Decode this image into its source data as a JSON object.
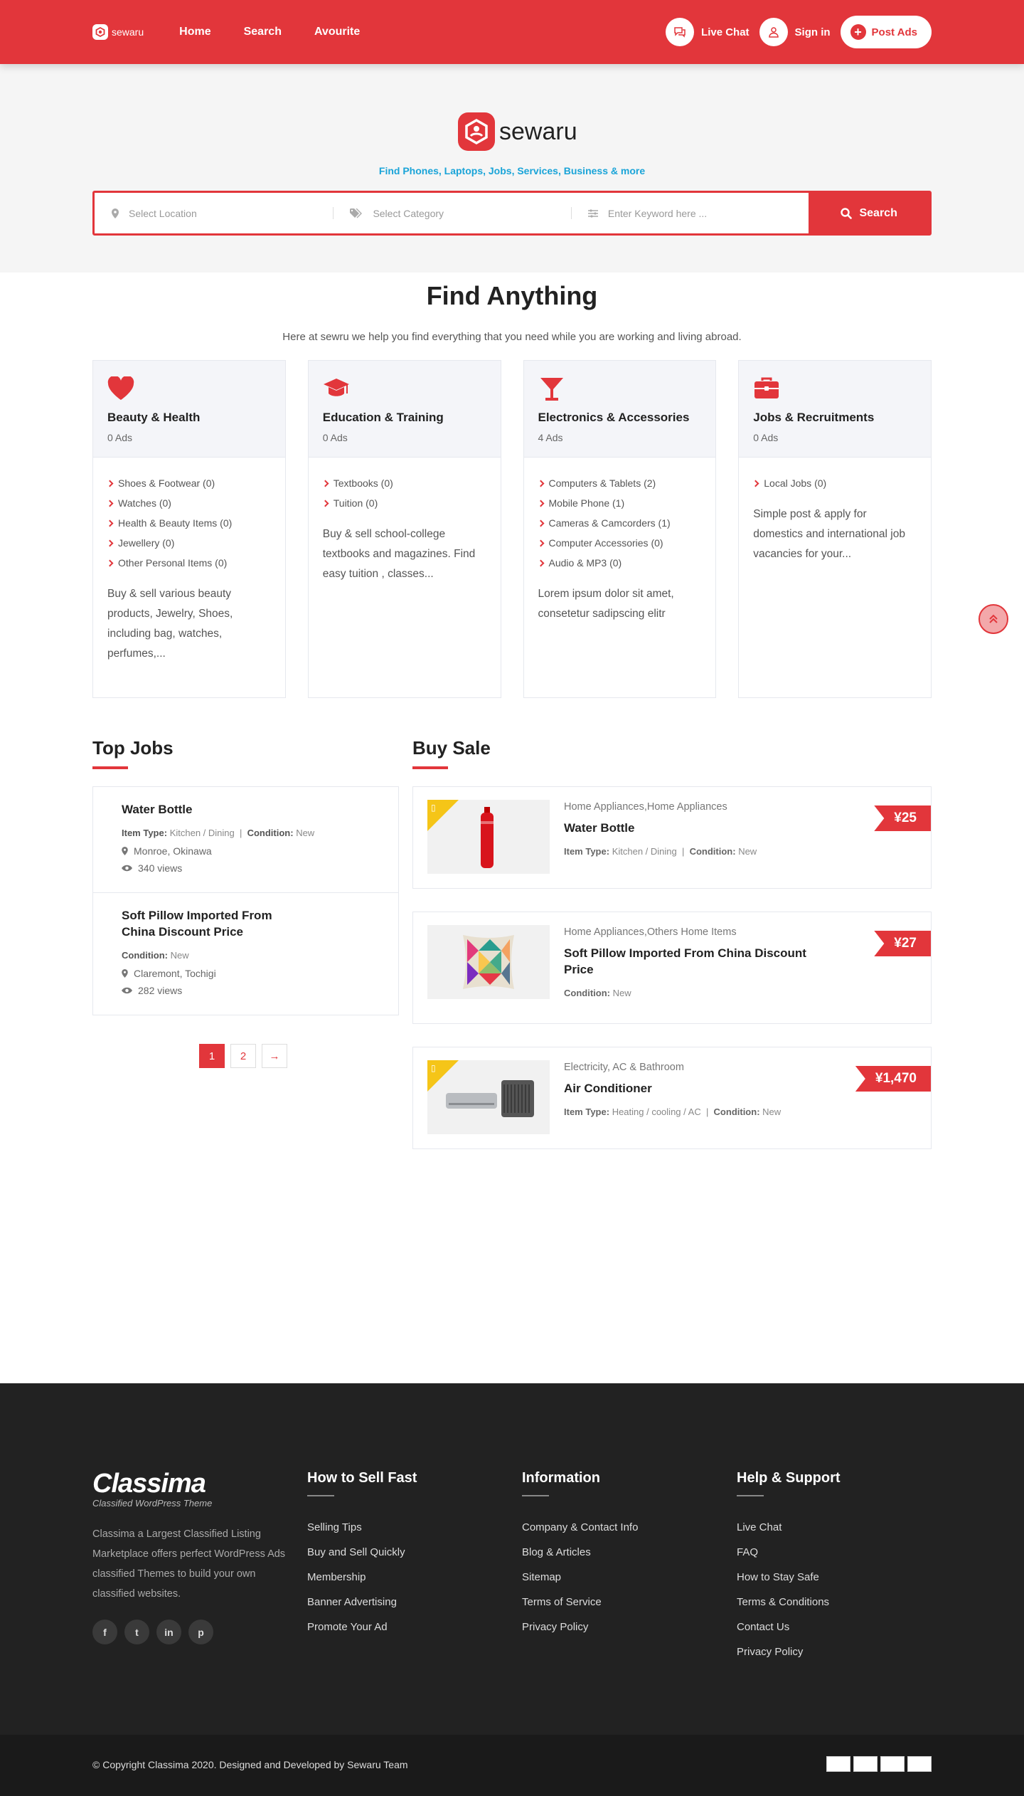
{
  "header": {
    "brand": "sewaru",
    "nav": [
      "Home",
      "Search",
      "Avourite"
    ],
    "live_chat": "Live Chat",
    "sign_in": "Sign in",
    "post_ads": "Post Ads"
  },
  "hero": {
    "brand": "sewaru",
    "tagline": "Find Phones, Laptops, Jobs, Services, Business & more",
    "location_placeholder": "Select Location",
    "category_placeholder": "Select Category",
    "keyword_placeholder": "Enter Keyword here ...",
    "search_label": "Search"
  },
  "find": {
    "title": "Find Anything",
    "description": "Here at sewru we help you find everything that you need while you are working and living abroad."
  },
  "categories": [
    {
      "icon": "heart-icon",
      "title": "Beauty & Health",
      "count": "0 Ads",
      "items": [
        "Shoes & Footwear (0)",
        "Watches (0)",
        "Health & Beauty Items (0)",
        "Jewellery (0)",
        "Other Personal Items (0)"
      ],
      "desc": "Buy & sell various beauty products, Jewelry, Shoes, including bag, watches, perfumes,..."
    },
    {
      "icon": "graduation-cap-icon",
      "title": "Education & Training",
      "count": "0 Ads",
      "items": [
        "Textbooks (0)",
        "Tuition (0)"
      ],
      "desc": "Buy & sell school-college textbooks and magazines. Find easy tuition , classes..."
    },
    {
      "icon": "cocktail-glass-icon",
      "title": "Electronics & Accessories",
      "count": "4 Ads",
      "items": [
        "Computers & Tablets (2)",
        "Mobile Phone (1)",
        "Cameras & Camcorders (1)",
        "Computer Accessories (0)",
        "Audio & MP3 (0)"
      ],
      "desc": "Lorem ipsum dolor sit amet, consetetur sadipscing elitr"
    },
    {
      "icon": "briefcase-icon",
      "title": "Jobs & Recruitments",
      "count": "0 Ads",
      "items": [
        "Local Jobs (0)"
      ],
      "desc": "Simple post & apply for domestics and international job vacancies for your..."
    }
  ],
  "top_jobs": {
    "title": "Top Jobs",
    "jobs": [
      {
        "title": "Water Bottle",
        "item_type_label": "Item Type:",
        "item_type": "Kitchen / Dining",
        "condition_label": "Condition:",
        "condition": "New",
        "location": "Monroe, Okinawa",
        "views": "340 views"
      },
      {
        "title": "Soft Pillow Imported From China Discount Price",
        "condition_label": "Condition:",
        "condition": "New",
        "location": "Claremont, Tochigi",
        "views": "282 views"
      }
    ],
    "pages": [
      "1",
      "2",
      "→"
    ]
  },
  "buy_sale": {
    "title": "Buy Sale",
    "items": [
      {
        "category": "Home Appliances,Home Appliances",
        "title": "Water Bottle",
        "item_type_label": "Item Type:",
        "item_type": "Kitchen / Dining",
        "condition_label": "Condition:",
        "condition": "New",
        "price": "¥25",
        "featured": true
      },
      {
        "category": "Home Appliances,Others Home Items",
        "title": "Soft Pillow Imported From China Discount Price",
        "condition_label": "Condition:",
        "condition": "New",
        "price": "¥27",
        "featured": false
      },
      {
        "category": "Electricity, AC & Bathroom",
        "title": "Air Conditioner",
        "item_type_label": "Item Type:",
        "item_type": "Heating / cooling / AC",
        "condition_label": "Condition:",
        "condition": "New",
        "price": "¥1,470",
        "featured": true
      }
    ]
  },
  "footer": {
    "brand": "Classima",
    "brand_sub": "Classified WordPress Theme",
    "description": "Classima a Largest Classified Listing Marketplace offers perfect WordPress Ads classified Themes to build your own classified websites.",
    "social": [
      "f",
      "t",
      "in",
      "p"
    ],
    "columns": [
      {
        "title": "How to Sell Fast",
        "links": [
          "Selling Tips",
          "Buy and Sell Quickly",
          "Membership",
          "Banner Advertising",
          "Promote Your Ad"
        ]
      },
      {
        "title": "Information",
        "links": [
          "Company & Contact Info",
          "Blog & Articles",
          "Sitemap",
          "Terms of Service",
          "Privacy Policy"
        ]
      },
      {
        "title": "Help & Support",
        "links": [
          "Live Chat",
          "FAQ",
          "How to Stay Safe",
          "Terms & Conditions",
          "Contact Us",
          "Privacy Policy"
        ]
      }
    ],
    "copyright": "© Copyright Classima 2020. Designed and Developed by Sewaru Team"
  },
  "colors": {
    "accent": "#e2363b",
    "tagline": "#1aa4d8",
    "footer_bg": "#222222"
  }
}
